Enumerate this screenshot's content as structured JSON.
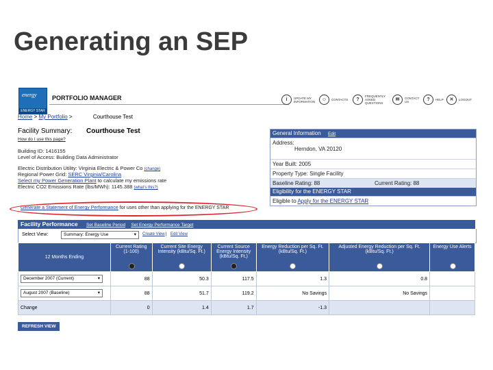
{
  "slide_title": "Generating an SEP",
  "logo": {
    "text": "energy",
    "bottom": "ENERGY STAR"
  },
  "app_title": "PORTFOLIO MANAGER",
  "top_nav": [
    {
      "icon": "account-icon",
      "glyph": "i",
      "label": "UPDATE MY INFORMATION"
    },
    {
      "icon": "contacts-icon",
      "glyph": "☺",
      "label": "CONTACTS"
    },
    {
      "icon": "faq-icon",
      "glyph": "?",
      "label": "FREQUENTLY ASKED QUESTIONS"
    },
    {
      "icon": "contact-us-icon",
      "glyph": "✉",
      "label": "CONTACT US"
    },
    {
      "icon": "help-icon",
      "glyph": "?",
      "label": "HELP"
    },
    {
      "icon": "logout-icon",
      "glyph": "✕",
      "label": "LOGOUT"
    }
  ],
  "breadcrumb": {
    "home": "Home",
    "sep1": " > ",
    "portfolio": "My Portfolio",
    "sep2": " > ",
    "current": "Courthouse Test"
  },
  "facility_summary": {
    "label": "Facility Summary:",
    "name": "Courthouse Test",
    "help_link": "How do I use this page?",
    "building_id": "Building ID: 1416155",
    "access": "Level of Access: Building Data Administrator",
    "utility": "Electric Distribution Utility: Virginia Electric & Power Co",
    "utility_change": "(change)",
    "power_grid_prefix": "Regional Power Grid: ",
    "power_grid": "SERC Virginia/Carolina",
    "power_plant_link": "Select my Power Generation Plant",
    "power_plant_suffix": " to calculate my emissions rate",
    "emissions": "Electric CO2 Emissions Rate (lbs/MWh): 1145.388",
    "emissions_link": "(what's this?)"
  },
  "general_info": {
    "header": "General Information",
    "edit": "Edit",
    "address_label": "Address:",
    "address": "Herndon, VA 20120",
    "year_built": "Year Built: 2005",
    "property_type": "Property Type: Single Facility",
    "baseline_rating": "Baseline Rating: 88",
    "current_rating": "Current Rating: 88",
    "eligibility_header": "Eligibility for the ENERGY STAR",
    "eligible_prefix": "Eligible to ",
    "eligible_link": "Apply for the ENERGY STAR"
  },
  "sep_line": {
    "link": "Generate a Statement of Energy Performance",
    "suffix": " for uses other than applying for the ENERGY STAR"
  },
  "facility_performance": {
    "header": "Facility Performance",
    "set_baseline": "Set Baseline Period",
    "set_target": "Set Energy Performance Target",
    "select_view_label": "Select View:",
    "select_view_value": "Summary: Energy Use",
    "create_view": "Create View",
    "edit_view": "Edit View",
    "columns": [
      "12 Months Ending",
      "Current Rating (1-100)",
      "Current Site Energy Intensity (kBtu/Sq. Ft.)",
      "Current Source Energy Intensity (kBtu/Sq. Ft.)",
      "Energy Reduction per Sq. Ft. (kBtu/Sq. Ft.)",
      "Adjusted Energy Reduction per Sq. Ft. (kBtu/Sq. Ft.)",
      "Energy Use Alerts"
    ],
    "rows": [
      {
        "period": "December 2007 (Current)",
        "rating": "88",
        "site": "50.3",
        "source": "117.5",
        "reduction": "1.3",
        "adjusted": "0.8",
        "alerts": ""
      },
      {
        "period": "August 2007 (Baseline)",
        "rating": "88",
        "site": "51.7",
        "source": "119.2",
        "reduction": "No Savings",
        "adjusted": "No Savings",
        "alerts": ""
      },
      {
        "period": "Change",
        "rating": "0",
        "site": "1.4",
        "source": "1.7",
        "reduction": "-1.3",
        "adjusted": "",
        "alerts": ""
      }
    ],
    "refresh": "REFRESH VIEW"
  },
  "colors": {
    "header_blue": "#3a5a9a",
    "highlight_red": "#d8262b",
    "link_blue": "#1c3c9c"
  }
}
